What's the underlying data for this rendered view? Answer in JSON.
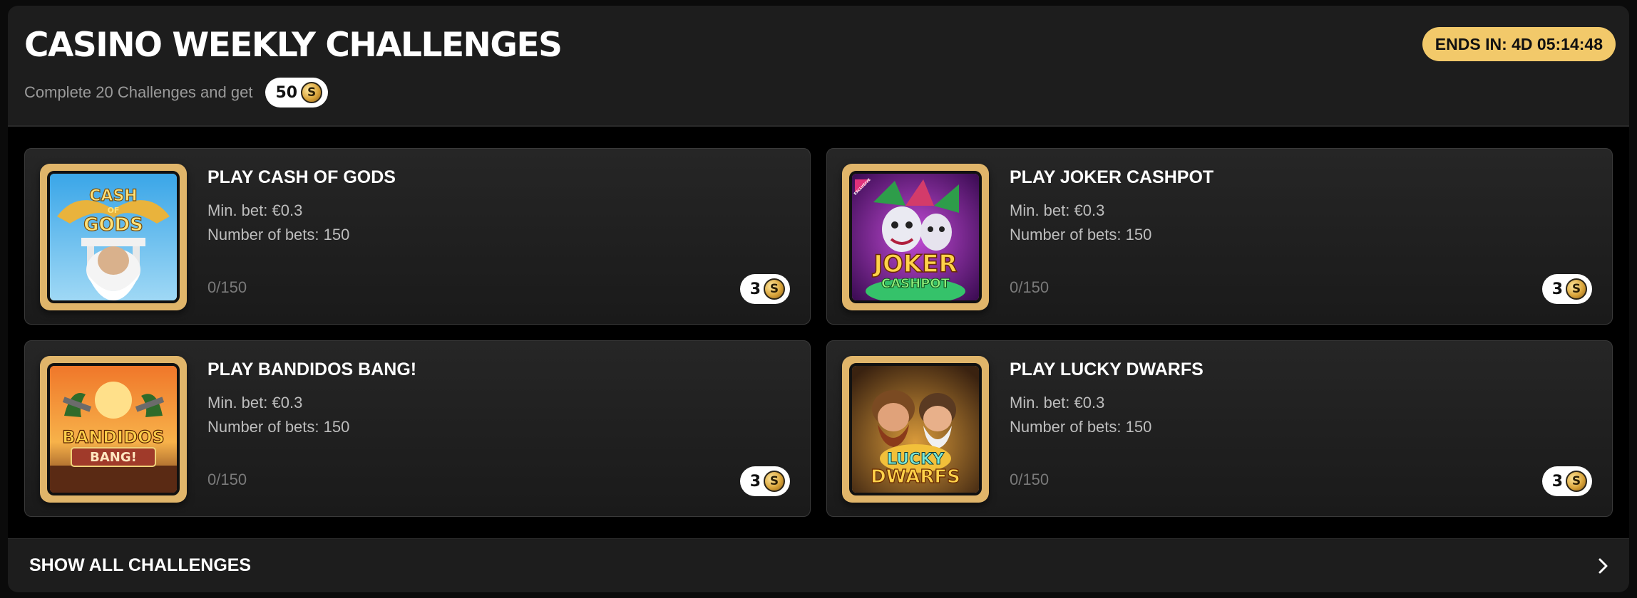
{
  "header": {
    "title": "CASINO WEEKLY CHALLENGES",
    "subtitle": "Complete 20 Challenges and get",
    "reward_amount": "50",
    "ends_label": "ENDS IN: 4D 05:14:48"
  },
  "coin_symbol": "S",
  "challenges": [
    {
      "title": "PLAY CASH OF GODS",
      "min_bet": "Min. bet: €0.3",
      "num_bets": "Number of bets: 150",
      "progress": "0/150",
      "reward": "3",
      "thumb_text_1": "CASH",
      "thumb_text_2": "OF",
      "thumb_text_3": "GODS"
    },
    {
      "title": "PLAY JOKER CASHPOT",
      "min_bet": "Min. bet: €0.3",
      "num_bets": "Number of bets: 150",
      "progress": "0/150",
      "reward": "3",
      "thumb_text_1": "JOKER",
      "thumb_text_2": "CASHPOT",
      "thumb_badge": "EXCLUSIVE"
    },
    {
      "title": "PLAY BANDIDOS BANG!",
      "min_bet": "Min. bet: €0.3",
      "num_bets": "Number of bets: 150",
      "progress": "0/150",
      "reward": "3",
      "thumb_text_1": "BANDIDOS",
      "thumb_text_2": "BANG!"
    },
    {
      "title": "PLAY LUCKY DWARFS",
      "min_bet": "Min. bet: €0.3",
      "num_bets": "Number of bets: 150",
      "progress": "0/150",
      "reward": "3",
      "thumb_text_1": "LUCKY",
      "thumb_text_2": "DWARFS"
    }
  ],
  "footer": {
    "label": "SHOW ALL CHALLENGES",
    "icon": "chevron-right-icon"
  },
  "colors": {
    "accent": "#f2c96a",
    "thumb_frame": "#e0b56a",
    "panel": "#1d1d1d"
  }
}
